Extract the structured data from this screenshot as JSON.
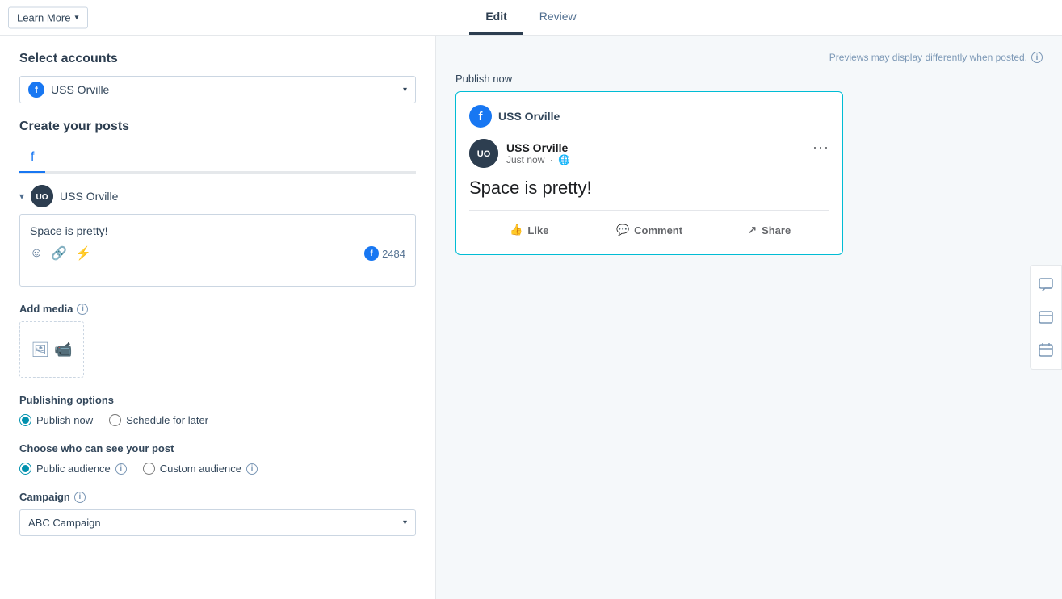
{
  "topbar": {
    "learn_more_label": "Learn More",
    "tabs": [
      {
        "id": "edit",
        "label": "Edit",
        "active": true
      },
      {
        "id": "review",
        "label": "Review",
        "active": false
      }
    ]
  },
  "left_panel": {
    "select_accounts": {
      "title": "Select accounts",
      "account_name": "USS Orville",
      "placeholder": "USS Orville"
    },
    "create_posts": {
      "title": "Create your posts",
      "platform_tab": "f"
    },
    "post": {
      "account_name": "USS Orville",
      "post_text": "Space is pretty!",
      "char_count": "2484"
    },
    "add_media": {
      "label": "Add media"
    },
    "publishing_options": {
      "label": "Publishing options",
      "options": [
        {
          "id": "publish_now",
          "label": "Publish now",
          "selected": true
        },
        {
          "id": "schedule_later",
          "label": "Schedule for later",
          "selected": false
        }
      ]
    },
    "audience": {
      "label": "Choose who can see your post",
      "options": [
        {
          "id": "public",
          "label": "Public audience",
          "selected": true
        },
        {
          "id": "custom",
          "label": "Custom audience",
          "selected": false
        }
      ]
    },
    "campaign": {
      "label": "Campaign",
      "value": "ABC Campaign"
    }
  },
  "right_panel": {
    "preview_note": "Previews may display differently when posted.",
    "publish_label": "Publish now",
    "preview": {
      "platform_name": "USS Orville",
      "account_name": "USS Orville",
      "time": "Just now",
      "post_text": "Space is pretty!",
      "actions": [
        {
          "id": "like",
          "label": "Like"
        },
        {
          "id": "comment",
          "label": "Comment"
        },
        {
          "id": "share",
          "label": "Share"
        }
      ]
    }
  },
  "right_sidebar": {
    "icons": [
      {
        "id": "chat",
        "symbol": "💬"
      },
      {
        "id": "browser",
        "symbol": "🖥"
      },
      {
        "id": "calendar",
        "symbol": "📅"
      }
    ]
  },
  "icons": {
    "chevron_down": "▾",
    "info": "i",
    "emoji": "😊",
    "clip": "📎",
    "lightning": "⚡",
    "globe": "🌐",
    "dots": "•••",
    "like": "👍",
    "comment": "💬",
    "share": "↗"
  }
}
